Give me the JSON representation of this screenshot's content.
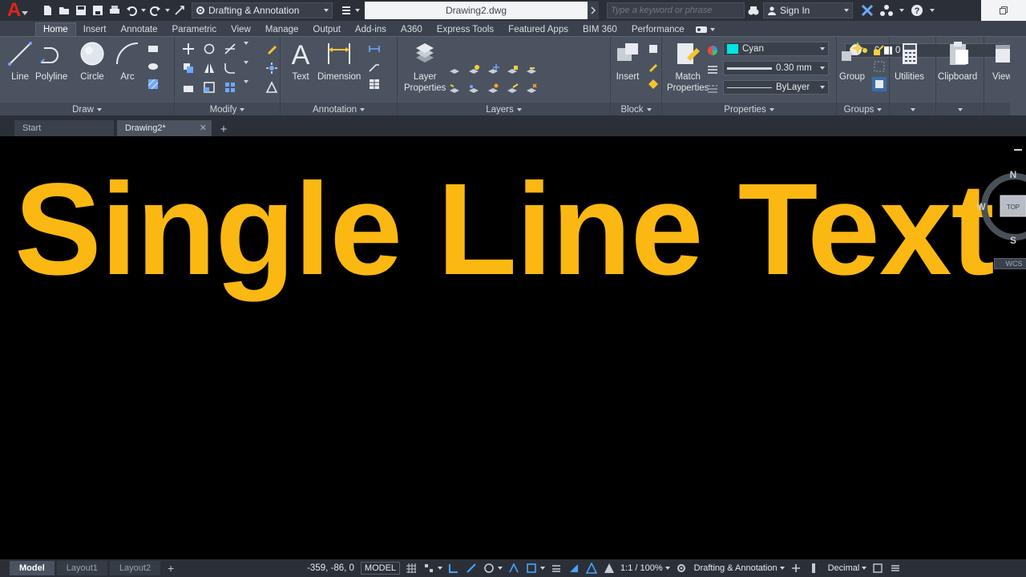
{
  "titlebar": {
    "app_logo": "A",
    "workspace": "Drafting & Annotation",
    "document": "Drawing2.dwg",
    "search_placeholder": "Type a keyword or phrase",
    "signin": "Sign In"
  },
  "ribbon_tabs": [
    {
      "label": "Home",
      "active": true
    },
    {
      "label": "Insert"
    },
    {
      "label": "Annotate"
    },
    {
      "label": "Parametric"
    },
    {
      "label": "View"
    },
    {
      "label": "Manage"
    },
    {
      "label": "Output"
    },
    {
      "label": "Add-ins"
    },
    {
      "label": "A360"
    },
    {
      "label": "Express Tools"
    },
    {
      "label": "Featured Apps"
    },
    {
      "label": "BIM 360"
    },
    {
      "label": "Performance"
    }
  ],
  "panels": {
    "draw": {
      "title": "Draw",
      "tools": [
        "Line",
        "Polyline",
        "Circle",
        "Arc"
      ]
    },
    "modify": {
      "title": "Modify"
    },
    "annotation": {
      "title": "Annotation",
      "tools": [
        "Text",
        "Dimension"
      ]
    },
    "layers": {
      "title": "Layers",
      "tool_line1": "Layer",
      "tool_line2": "Properties",
      "current_layer": "0"
    },
    "block": {
      "title": "Block",
      "tool": "Insert"
    },
    "properties": {
      "title": "Properties",
      "tool_line1": "Match",
      "tool_line2": "Properties",
      "color": "Cyan",
      "lineweight": "0.30 mm",
      "linetype": "ByLayer"
    },
    "groups": {
      "title": "Groups",
      "tool": "Group"
    },
    "utilities": {
      "tool": "Utilities"
    },
    "clipboard": {
      "tool": "Clipboard"
    },
    "view": {
      "tool": "View"
    }
  },
  "file_tabs": [
    {
      "label": "Start"
    },
    {
      "label": "Drawing2*",
      "active": true
    }
  ],
  "viewcube": {
    "north": "N",
    "south": "S",
    "west": "W",
    "face": "TOP",
    "ucs": "WCS"
  },
  "overlay": {
    "title": "Single Line Text"
  },
  "statusbar": {
    "layout_tabs": [
      {
        "label": "Model",
        "active": true
      },
      {
        "label": "Layout1"
      },
      {
        "label": "Layout2"
      }
    ],
    "coords": "-359, -86, 0",
    "space": "MODEL",
    "scale": "1:1 / 100%",
    "workspace": "Drafting & Annotation",
    "units": "Decimal"
  },
  "colors": {
    "titlebar_bg": "#2b3038",
    "ribbon_bg": "#4b5360",
    "canvas_bg": "#000000",
    "overlay_text": "#fbb812",
    "app_logo_red": "#e1251b",
    "swatch_cyan": "#00e5e5"
  }
}
